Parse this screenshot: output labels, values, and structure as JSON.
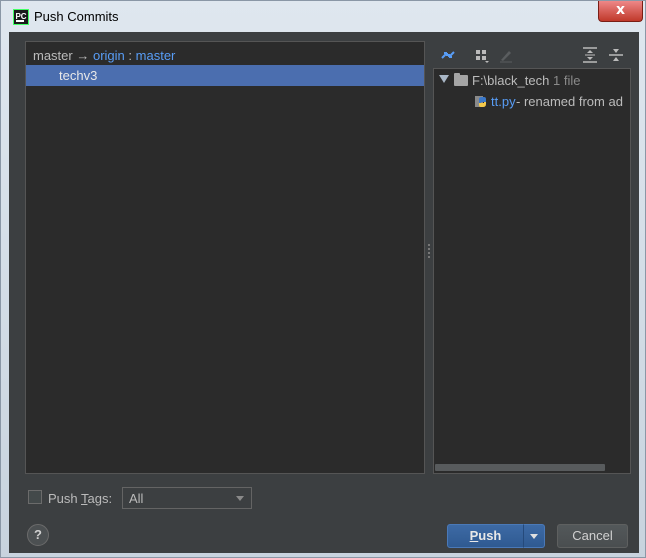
{
  "window": {
    "title": "Push Commits",
    "close_glyph": "x",
    "app_icon": "PC"
  },
  "branch": {
    "local": "master",
    "arrow": "→",
    "remote": "origin",
    "sep": ":",
    "remote_branch": "master"
  },
  "commits": [
    {
      "label": "techv3",
      "selected": true
    }
  ],
  "toolbar": {
    "icons": [
      "sync-icon",
      "group-by-icon",
      "edit-icon",
      "expand-all-icon",
      "collapse-all-icon"
    ]
  },
  "tree": {
    "root": {
      "path": "F:\\black_tech",
      "count": "1 file"
    },
    "files": [
      {
        "name": "tt.py",
        "note": " - renamed from ad"
      }
    ]
  },
  "footer": {
    "push_tags_label_pre": "Push ",
    "push_tags_mnemonic": "T",
    "push_tags_label_post": "ags:",
    "tags_select_value": "All",
    "help_glyph": "?",
    "push_mnemonic": "P",
    "push_rest": "ush",
    "cancel_label": "Cancel"
  },
  "colors": {
    "accent": "#589df6",
    "selection": "#4b6eaf",
    "bg": "#3c3f41",
    "panel": "#2b2b2b"
  }
}
